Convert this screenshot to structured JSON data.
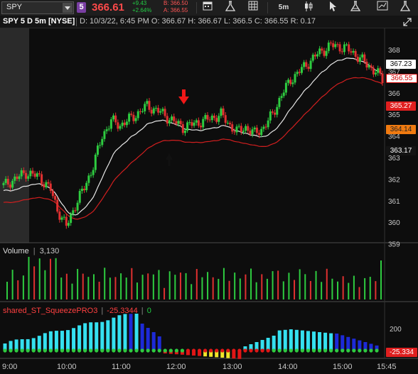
{
  "toolbar": {
    "symbol": "SPY",
    "badge": "5",
    "last_price": "366.61",
    "change_abs": "+9.43",
    "change_pct": "+2.64%",
    "bid": "B: 366.50",
    "ask": "A: 366.55",
    "timeframe": "5m"
  },
  "header": {
    "title": "SPY 5 D 5m [NYSE]",
    "info": "D: 10/3/22, 6:45 PM   O: 366.67   H: 366.67   L: 366.5   C: 366.55   R: 0.17"
  },
  "price_axis": {
    "ticks": [
      "368",
      "367",
      "366",
      "365",
      "364",
      "363",
      "362",
      "361",
      "360",
      "359"
    ],
    "tags": {
      "white_ma": "367.23",
      "last": "366.55",
      "red_ma": "365.27",
      "orange": "364.14",
      "dark": "363.17"
    }
  },
  "volume_pane": {
    "label": "Volume",
    "value": "3,130"
  },
  "study_pane": {
    "label": "shared_ST_SqueezePRO3",
    "value": "-25.3344",
    "value2": "0",
    "axis_tick": "200",
    "tag": "-25.334"
  },
  "time_axis": {
    "labels": [
      "9:00",
      "10:00",
      "11:00",
      "12:00",
      "13:00",
      "14:00",
      "15:00",
      "15:45"
    ]
  },
  "colors": {
    "up": "#2ecc40",
    "down": "#e03030",
    "ma_white": "#e6e6e6",
    "ma_red": "#d11f1f",
    "squeeze_cyan": "#35e0f0",
    "squeeze_blue": "#1d2ad8",
    "squeeze_red": "#e01616",
    "squeeze_yellow": "#f0e62a"
  }
}
